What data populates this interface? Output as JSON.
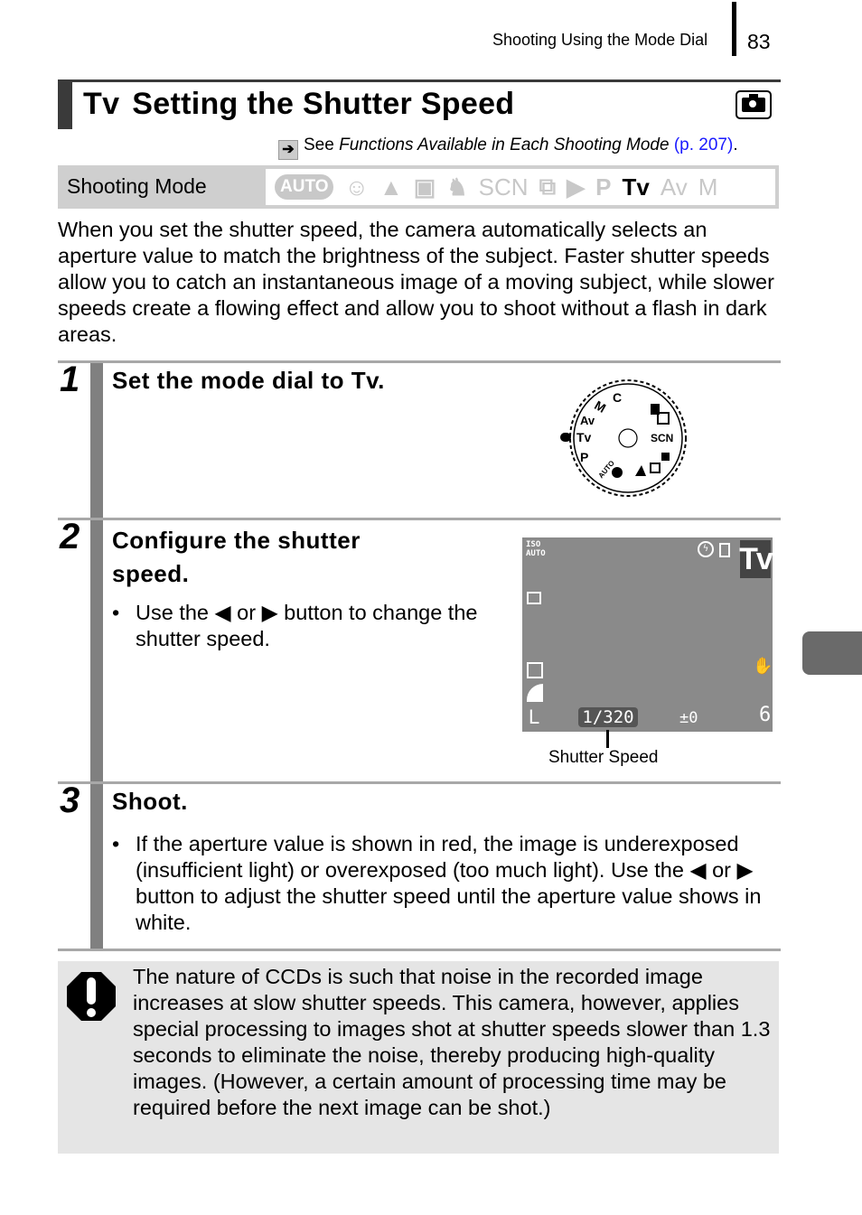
{
  "header": {
    "running_head": "Shooting Using the Mode Dial",
    "page_number": "83"
  },
  "title": {
    "mode_glyph": "Tv",
    "text": "Setting the Shutter Speed",
    "icon": "camera-icon"
  },
  "reference": {
    "prefix": "See ",
    "italic": "Functions Available in Each Shooting Mode",
    "link": "(p. 207)",
    "suffix": ".",
    "link_color": "#1a1aff"
  },
  "shooting_mode": {
    "label": "Shooting Mode",
    "modes": [
      {
        "name": "AUTO",
        "glyph": "AUTO",
        "active": false
      },
      {
        "name": "portrait",
        "glyph": "☺",
        "active": false
      },
      {
        "name": "landscape",
        "glyph": "▲",
        "active": false
      },
      {
        "name": "night-scene",
        "glyph": "▣",
        "active": false
      },
      {
        "name": "kids-pets",
        "glyph": "♞",
        "active": false
      },
      {
        "name": "SCN",
        "glyph": "SCN",
        "active": false
      },
      {
        "name": "stitch-assist",
        "glyph": "⧉",
        "active": false
      },
      {
        "name": "movie",
        "glyph": "▶",
        "active": false
      },
      {
        "name": "P",
        "glyph": "P",
        "active": false
      },
      {
        "name": "Tv",
        "glyph": "Tv",
        "active": true
      },
      {
        "name": "Av",
        "glyph": "Av",
        "active": false
      },
      {
        "name": "M",
        "glyph": "M",
        "active": false
      }
    ]
  },
  "intro": "When you set the shutter speed, the camera automatically selects an aperture value to match the brightness of the subject. Faster shutter speeds allow you to catch an instantaneous image of a moving subject, while slower speeds create a flowing effect and allow you to shoot without a flash in dark areas.",
  "steps": [
    {
      "number": "1",
      "title": "Set the mode dial to Tv."
    },
    {
      "number": "2",
      "title": "Configure the shutter speed.",
      "bullet": "Use the ◆ or ◆ button to change the shutter speed."
    },
    {
      "number": "3",
      "title": "Shoot.",
      "bullet": "If the aperture value is shown in red, the image is underexposed (insufficient light) or overexposed (too much light). Use the ◆ or ◆ button to adjust the shutter speed until the aperture value shows in white."
    }
  ],
  "step2_bullet_parts": {
    "a": "Use the ",
    "b": " or ",
    "c": " button to change the shutter speed."
  },
  "step3_bullet_parts": {
    "a": "If the aperture value is shown in red, the image is underexposed (insufficient light) or overexposed (too much light). Use the ",
    "b": " or ",
    "c": " button to adjust the shutter speed until the aperture value shows in white."
  },
  "dial": {
    "labels": [
      "C",
      "M",
      "Av",
      "Tv",
      "P",
      "AUTO",
      "SCN"
    ],
    "selected": "Tv"
  },
  "lcd": {
    "iso": "ISO AUTO",
    "mode_badge": "Tv",
    "shutter_speed": "1/320",
    "exposure_comp": "±0",
    "shots_remaining": "6",
    "image_size": "L",
    "callout": "Shutter Speed"
  },
  "caution": {
    "text": "The nature of CCDs is such that noise in the recorded image increases at slow shutter speeds. This camera, however, applies special processing to images shot at shutter speeds slower than 1.3 seconds to eliminate the noise, thereby producing high-quality images. (However, a certain amount of processing time may be required before the next image can be shot.)"
  },
  "bullet_char": "•"
}
